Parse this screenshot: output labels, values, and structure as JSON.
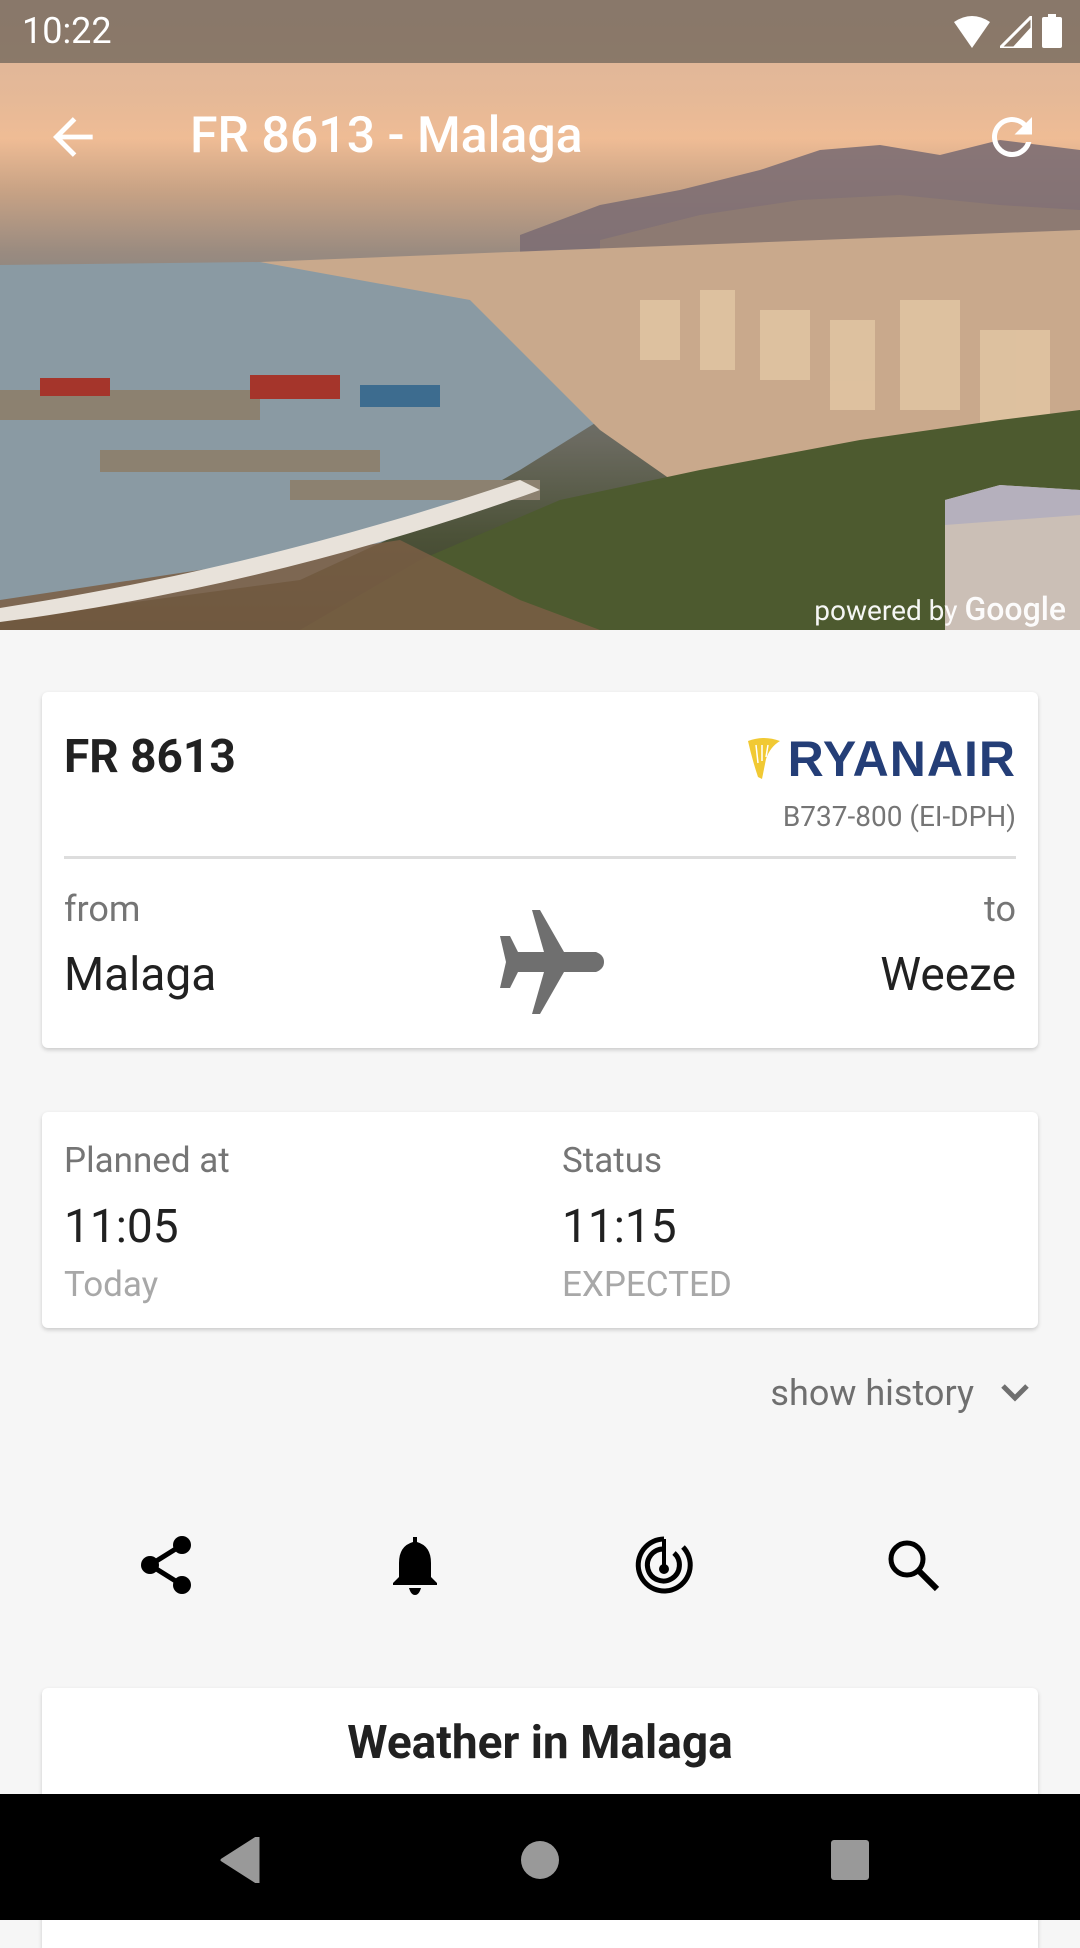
{
  "status_bar": {
    "time": "10:22",
    "icons": [
      "wifi-icon",
      "cellular-signal-icon",
      "battery-icon"
    ]
  },
  "app_bar": {
    "title": "FR 8613 - Malaga",
    "back_icon": "arrow-back-icon",
    "refresh_icon": "refresh-icon"
  },
  "hero": {
    "attribution_prefix": "powered by",
    "attribution_brand": "Google"
  },
  "flight_card": {
    "flight_number": "FR 8613",
    "airline": "RYANAIR",
    "airline_brand_color": "#243e77",
    "airline_accent_color": "#f1c933",
    "aircraft": "B737-800  (EI-DPH)",
    "from_label": "from",
    "from_city": "Malaga",
    "to_label": "to",
    "to_city": "Weeze",
    "route_icon": "airplane-icon"
  },
  "schedule_card": {
    "planned": {
      "label": "Planned at",
      "time": "11:05",
      "sub": "Today"
    },
    "status": {
      "label": "Status",
      "time": "11:15",
      "sub": "EXPECTED"
    }
  },
  "history_toggle": {
    "label": "show history",
    "icon": "chevron-down-icon"
  },
  "actions": [
    {
      "name": "share",
      "icon": "share-icon"
    },
    {
      "name": "alert",
      "icon": "bell-icon"
    },
    {
      "name": "radar",
      "icon": "radar-icon"
    },
    {
      "name": "search",
      "icon": "search-icon"
    }
  ],
  "weather_card": {
    "title": "Weather in Malaga"
  },
  "nav_bar": {
    "buttons": [
      "back",
      "home",
      "recents"
    ]
  }
}
